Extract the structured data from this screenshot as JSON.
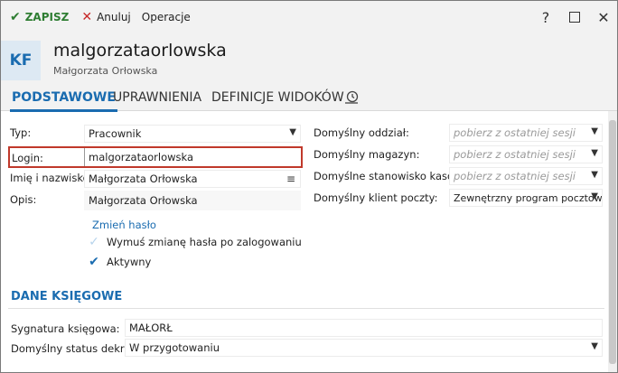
{
  "toolbar": {
    "save_label": "ZAPISZ",
    "cancel_label": "Anuluj",
    "operations_label": "Operacje",
    "help_symbol": "?",
    "close_symbol": "✕"
  },
  "header": {
    "avatar_initials": "KF",
    "title": "malgorzataorlowska",
    "subtitle": "Małgorzata Orłowska"
  },
  "tabs": [
    {
      "label": "PODSTAWOWE",
      "active": true
    },
    {
      "label": "UPRAWNIENIA",
      "active": false
    },
    {
      "label": "DEFINICJE WIDOKÓW",
      "active": false
    }
  ],
  "left_form": {
    "type": {
      "label": "Typ:",
      "value": "Pracownik"
    },
    "login": {
      "label": "Login:",
      "value": "malgorzataorlowska"
    },
    "name": {
      "label": "Imię i nazwisko:",
      "value": "Małgorzata Orłowska"
    },
    "description": {
      "label": "Opis:",
      "value": "Małgorzata Orłowska"
    },
    "change_password_link": "Zmień hasło",
    "force_password_change": {
      "label": "Wymuś zmianę hasła po zalogowaniu",
      "checked": false
    },
    "active": {
      "label": "Aktywny",
      "checked": true
    }
  },
  "right_form": {
    "branch": {
      "label": "Domyślny oddział:",
      "placeholder": "pobierz z ostatniej sesji"
    },
    "warehouse": {
      "label": "Domyślny magazyn:",
      "placeholder": "pobierz z ostatniej sesji"
    },
    "cash_station": {
      "label": "Domyślne stanowisko kasowe:",
      "placeholder": "pobierz z ostatniej sesji"
    },
    "mail_client": {
      "label": "Domyślny klient poczty:",
      "value": "Zewnętrzny program pocztowy"
    }
  },
  "accounting": {
    "section_title": "DANE KSIĘGOWE",
    "signature": {
      "label": "Sygnatura księgowa:",
      "value": "MAŁORŁ"
    },
    "decree_status": {
      "label": "Domyślny status dekretu:",
      "value": "W przygotowaniu"
    }
  },
  "colors": {
    "accent": "#1a6cb0",
    "save_green": "#2e7d32",
    "cancel_red": "#c62828",
    "highlight_red": "#c0392b"
  },
  "icons": {
    "save": "check-icon",
    "cancel": "x-icon",
    "help": "question-icon",
    "maximize": "maximize-icon",
    "close": "close-icon",
    "history": "history-icon",
    "dropdown": "chevron-down-icon",
    "name_menu": "menu-lines-icon"
  }
}
